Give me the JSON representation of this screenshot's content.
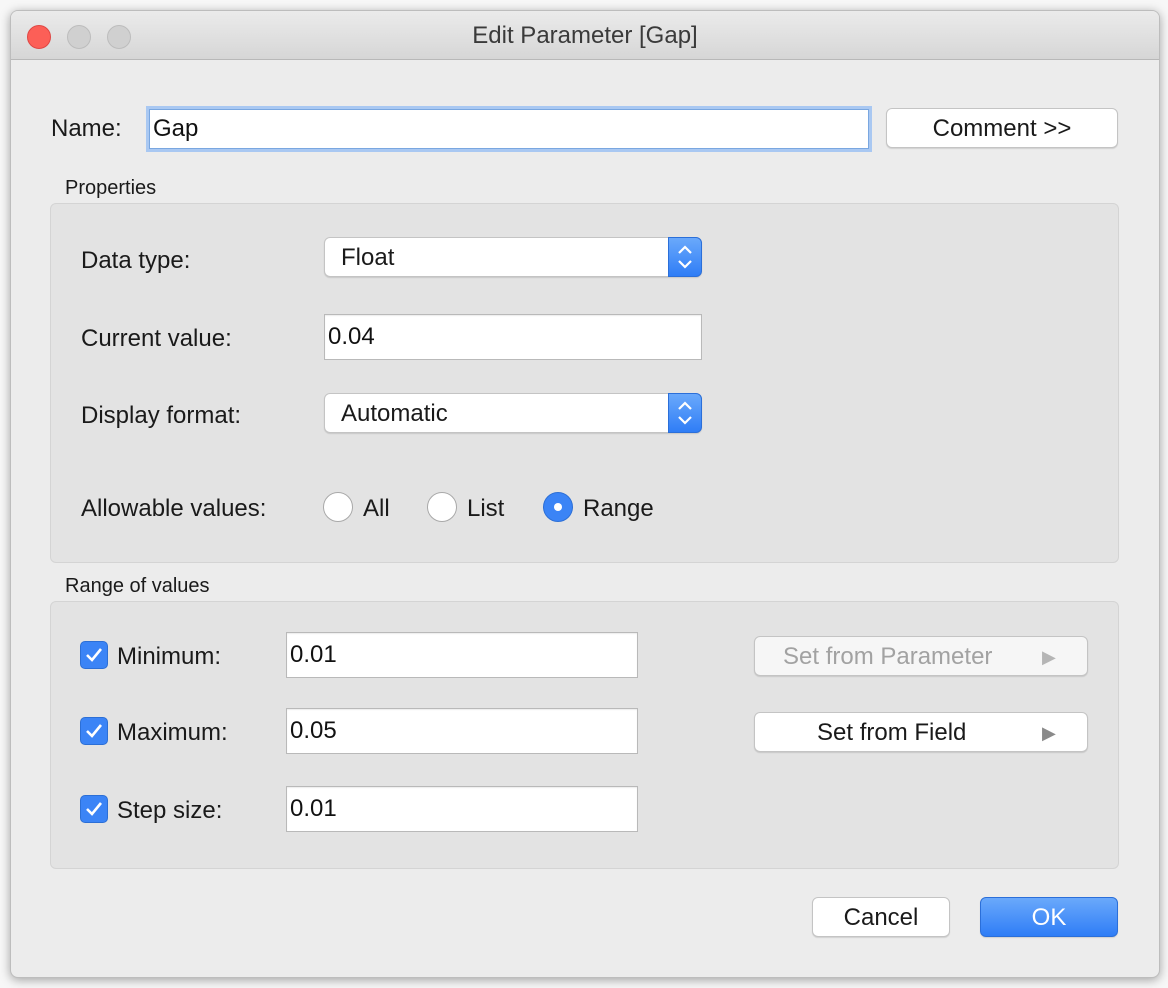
{
  "window": {
    "title": "Edit Parameter [Gap]"
  },
  "name_row": {
    "label": "Name:",
    "value": "Gap",
    "comment_button": "Comment >>"
  },
  "properties": {
    "section_title": "Properties",
    "data_type": {
      "label": "Data type:",
      "value": "Float"
    },
    "current_value": {
      "label": "Current value:",
      "value": "0.04"
    },
    "display_format": {
      "label": "Display format:",
      "value": "Automatic"
    },
    "allowable_values": {
      "label": "Allowable values:",
      "options": [
        {
          "label": "All",
          "selected": false
        },
        {
          "label": "List",
          "selected": false
        },
        {
          "label": "Range",
          "selected": true
        }
      ]
    }
  },
  "range": {
    "section_title": "Range of values",
    "minimum": {
      "label": "Minimum:",
      "value": "0.01",
      "checked": true
    },
    "maximum": {
      "label": "Maximum:",
      "value": "0.05",
      "checked": true
    },
    "step_size": {
      "label": "Step size:",
      "value": "0.01",
      "checked": true
    },
    "set_from_parameter": "Set from Parameter",
    "set_from_field": "Set from Field"
  },
  "footer": {
    "cancel": "Cancel",
    "ok": "OK"
  },
  "icons": {
    "arrow": "▶",
    "check": "check-icon",
    "stepper": "chevron-up-down-icon"
  },
  "colors": {
    "accent": "#3b84f6",
    "close": "#fc5f57",
    "focus_ring": "#a9c8f2"
  }
}
